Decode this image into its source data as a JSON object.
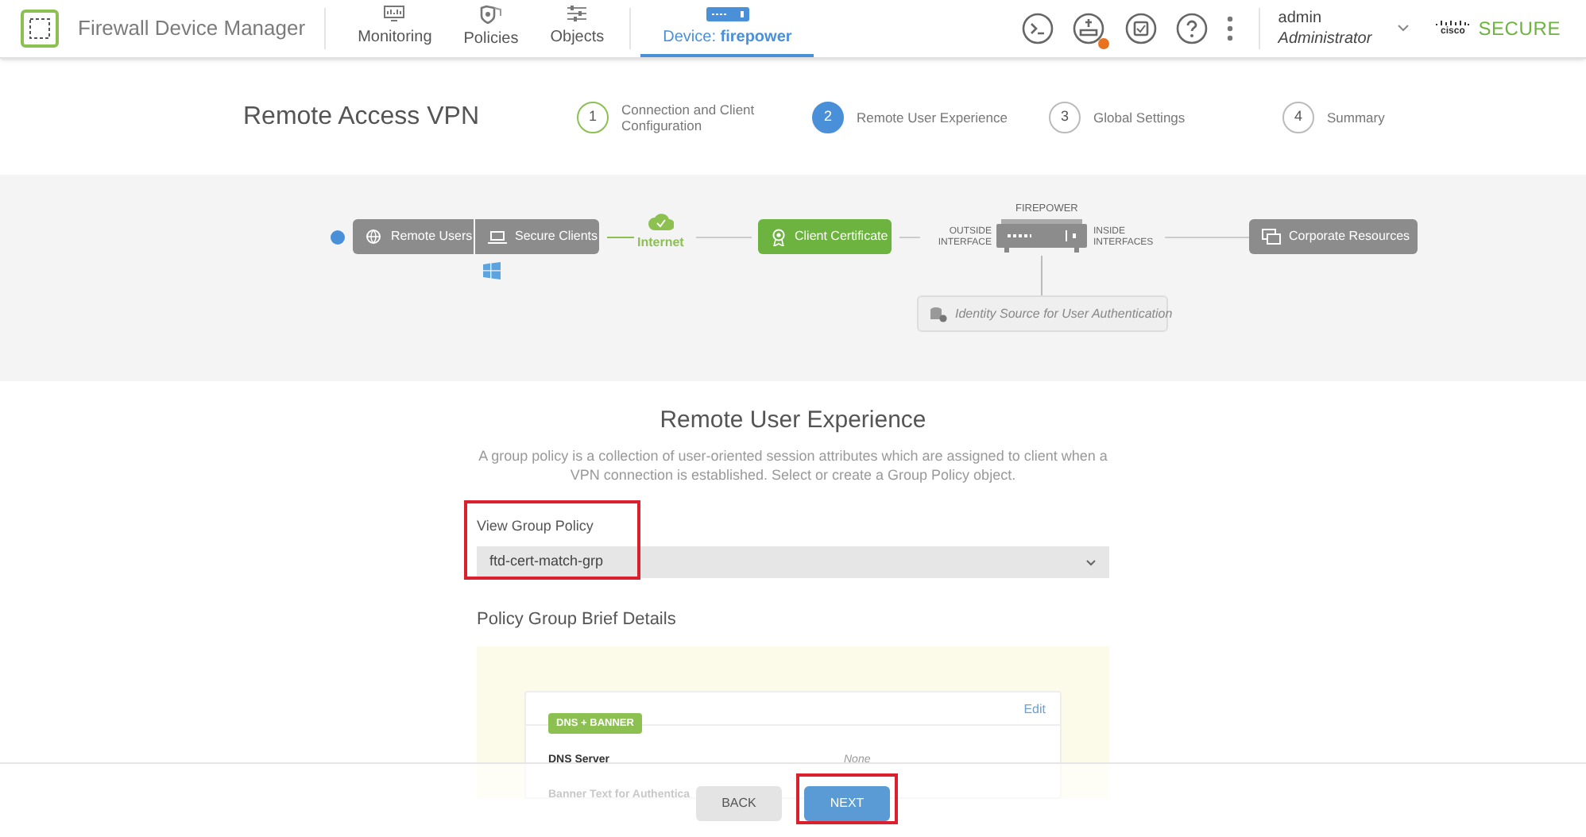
{
  "header": {
    "app_title": "Firewall Device Manager",
    "nav": [
      {
        "label": "Monitoring",
        "selected": false
      },
      {
        "label": "Policies",
        "selected": false
      },
      {
        "label": "Objects",
        "selected": false
      },
      {
        "label": "Device: **firepower**",
        "selected": true
      }
    ],
    "deploy_pending": true,
    "user": {
      "name": "admin",
      "role": "Administrator"
    },
    "brand": {
      "mark": "cisco",
      "product": "SECURE"
    }
  },
  "wizard": {
    "title": "Remote Access VPN",
    "steps": [
      {
        "number": "1",
        "label": "Connection and Client Configuration",
        "completed": true,
        "selected": false
      },
      {
        "number": "2",
        "label": "Remote User Experience",
        "completed": false,
        "selected": true
      },
      {
        "number": "3",
        "label": "Global Settings",
        "completed": false,
        "selected": false
      },
      {
        "number": "4",
        "label": "Summary",
        "completed": false,
        "selected": false
      }
    ]
  },
  "diagram": {
    "remote_users": "Remote Users",
    "secure_clients": "Secure Clients",
    "internet": "Internet",
    "client_certificate": "Client Certificate",
    "device_label": "FIREPOWER",
    "outside": "OUTSIDE INTERFACE",
    "inside": "INSIDE INTERFACES",
    "corporate": "Corporate Resources",
    "identity": "Identity Source for User Authentication"
  },
  "section": {
    "heading": "Remote User Experience",
    "description": "A group policy is a collection of user-oriented session attributes which are assigned to client when a VPN connection is established. Select or create a Group Policy object.",
    "policy_field": {
      "label": "View Group Policy",
      "value": "ftd-cert-match-grp",
      "highlighted": true
    },
    "details_heading": "Policy Group Brief Details",
    "card": {
      "edit": "Edit",
      "tag": "DNS + BANNER",
      "rows": [
        {
          "label": "DNS Server",
          "value": "None"
        },
        {
          "label": "Banner Text for Authentica"
        }
      ]
    }
  },
  "footer": {
    "buttons": [
      {
        "label": "BACK",
        "kind": "secondary",
        "highlighted": false
      },
      {
        "label": "NEXT",
        "kind": "primary",
        "highlighted": true
      }
    ]
  }
}
